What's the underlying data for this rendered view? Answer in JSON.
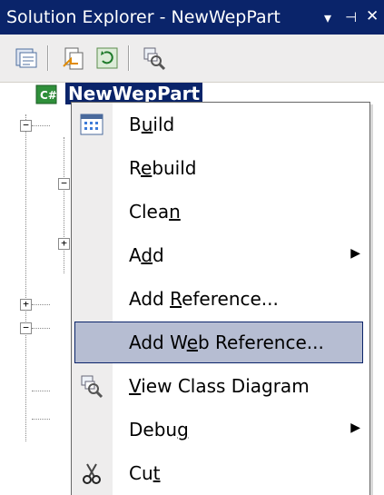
{
  "window": {
    "title": "Solution Explorer - NewWepPart",
    "title_icons": [
      "dropdown-arrow-icon",
      "pin-icon",
      "close-icon"
    ]
  },
  "toolbar": {
    "buttons": [
      "properties-icon",
      "show-all-files-icon",
      "refresh-icon",
      "view-class-diagram-icon"
    ]
  },
  "tree": {
    "project_node": "NewWepPart",
    "project_icon": "csharp-project-icon"
  },
  "context_menu": {
    "items": [
      {
        "label_pre": "B",
        "label_key": "u",
        "label_post": "ild",
        "icon": "build-icon",
        "submenu": false
      },
      {
        "label_pre": "R",
        "label_key": "e",
        "label_post": "build",
        "icon": "",
        "submenu": false
      },
      {
        "label_pre": "Clea",
        "label_key": "n",
        "label_post": "",
        "icon": "",
        "submenu": false
      },
      {
        "label_pre": "A",
        "label_key": "d",
        "label_post": "d",
        "icon": "",
        "submenu": true
      },
      {
        "label_pre": "Add ",
        "label_key": "R",
        "label_post": "eference...",
        "icon": "",
        "submenu": false
      },
      {
        "label_pre": "Add W",
        "label_key": "e",
        "label_post": "b Reference...",
        "icon": "",
        "submenu": false,
        "highlighted": true
      },
      {
        "label_pre": "",
        "label_key": "V",
        "label_post": "iew Class Diagram",
        "icon": "class-diagram-icon",
        "submenu": false
      },
      {
        "label_pre": "Debu",
        "label_key": "g",
        "label_post": "",
        "icon": "",
        "submenu": true
      },
      {
        "label_pre": "Cu",
        "label_key": "t",
        "label_post": "",
        "icon": "scissors-icon",
        "submenu": false
      }
    ]
  },
  "colors": {
    "titlebar": "#0a246a",
    "highlight_fill": "#b6bdd2",
    "highlight_border": "#0a246a",
    "menu_gutter": "#eeeded"
  }
}
